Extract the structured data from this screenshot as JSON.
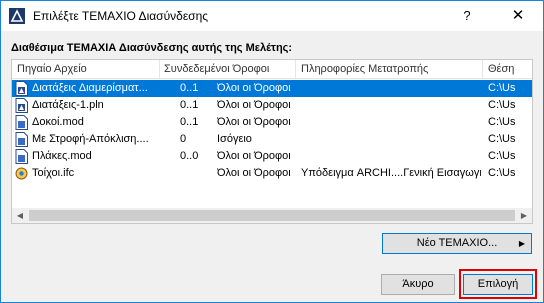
{
  "window": {
    "title": "Επιλέξτε ΤΕΜΑΧΙΟ Διασύνδεσης",
    "help_label": "?",
    "close_label": "✕"
  },
  "section": {
    "title": "Διαθέσιμα ΤΕΜΑΧΙΑ Διασύνδεσης αυτής της Μελέτης:"
  },
  "table": {
    "columns": [
      "Πηγαίο Αρχείο",
      "Συνδεδεμένοι Όροφοι",
      "Πληροφορίες Μετατροπής",
      "Θέση"
    ],
    "rows": [
      {
        "name": "Διατάξεις Διαμερίσματ...",
        "count": "0..1",
        "floors": "Όλοι οι Όροφοι",
        "info": "",
        "location": "C:\\Us",
        "icon": "pln-file-icon",
        "selected": true
      },
      {
        "name": "Διατάξεις-1.pln",
        "count": "0..1",
        "floors": "Όλοι οι Όροφοι",
        "info": "",
        "location": "C:\\Us",
        "icon": "pln-file-icon",
        "selected": false
      },
      {
        "name": "Δοκοί.mod",
        "count": "0..1",
        "floors": "Όλοι οι Όροφοι",
        "info": "",
        "location": "C:\\Us",
        "icon": "mod-file-icon",
        "selected": false
      },
      {
        "name": "Με Στροφή-Απόκλιση....",
        "count": "0",
        "floors": "Ισόγειο",
        "info": "",
        "location": "C:\\Us",
        "icon": "mod-file-icon",
        "selected": false
      },
      {
        "name": "Πλάκες.mod",
        "count": "0..0",
        "floors": "Όλοι οι Όροφοι",
        "info": "",
        "location": "C:\\Us",
        "icon": "mod-file-icon",
        "selected": false
      },
      {
        "name": "Τοίχοι.ifc",
        "count": "",
        "floors": "Όλοι οι Όροφοι",
        "info": "Υπόδειγμα ARCHI....Γενική Εισαγωγή",
        "location": "C:\\Us",
        "icon": "ifc-file-icon",
        "selected": false
      }
    ]
  },
  "buttons": {
    "new_label": "Νέο ΤΕΜΑΧΙΟ...",
    "new_arrow": "▶",
    "cancel_label": "Άκυρο",
    "select_label": "Επιλογή"
  },
  "scroll": {
    "left_arrow": "◀",
    "right_arrow": "▶"
  },
  "colors": {
    "selection": "#0078d7",
    "highlight_frame": "#e00000",
    "title_border": "#1883d7"
  }
}
